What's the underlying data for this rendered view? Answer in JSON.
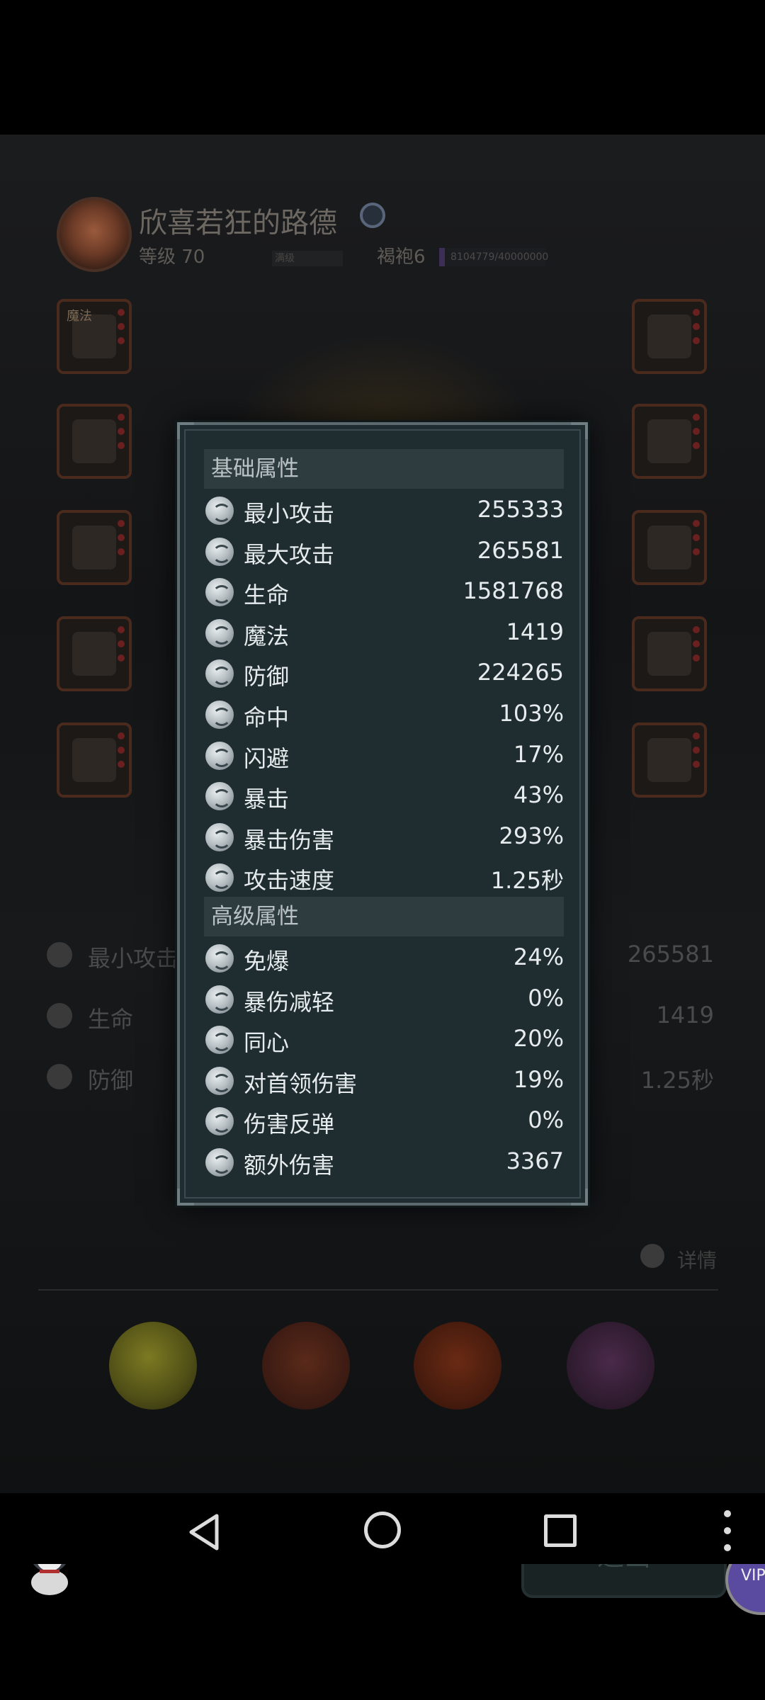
{
  "player": {
    "name": "欣喜若狂的路德",
    "level": "等级 70",
    "rank": "满级",
    "cloak": "褐袍6",
    "exp": "8104779/40000000"
  },
  "equipment": {
    "left_top_label": "魔法"
  },
  "background_stats": {
    "min_attack_label": "最小攻击",
    "life_label": "生命",
    "defense_label": "防御",
    "right_val_1": "265581",
    "right_val_2": "1419",
    "right_val_3": "1.25秒",
    "details_label": "详情"
  },
  "panel": {
    "basic_header": "基础属性",
    "basic": [
      {
        "icon": "sword-icon",
        "label": "最小攻击",
        "value": "255333"
      },
      {
        "icon": "sword-icon",
        "label": "最大攻击",
        "value": "265581"
      },
      {
        "icon": "heart-icon",
        "label": "生命",
        "value": "1581768"
      },
      {
        "icon": "magic-icon",
        "label": "魔法",
        "value": "1419"
      },
      {
        "icon": "shield-icon",
        "label": "防御",
        "value": "224265"
      },
      {
        "icon": "target-icon",
        "label": "命中",
        "value": "103%"
      },
      {
        "icon": "dodge-icon",
        "label": "闪避",
        "value": "17%"
      },
      {
        "icon": "critical-icon",
        "label": "暴击",
        "value": "43%"
      },
      {
        "icon": "critical-damage-icon",
        "label": "暴击伤害",
        "value": "293%"
      },
      {
        "icon": "attack-speed-icon",
        "label": "攻击速度",
        "value": "1.25秒"
      }
    ],
    "advanced_header": "高级属性",
    "advanced": [
      {
        "icon": "skull-icon",
        "label": "免爆",
        "value": "24%"
      },
      {
        "icon": "crit-reduction-icon",
        "label": "暴伤减轻",
        "value": "0%"
      },
      {
        "icon": "unity-icon",
        "label": "同心",
        "value": "20%"
      },
      {
        "icon": "boss-icon",
        "label": "对首领伤害",
        "value": "19%"
      },
      {
        "icon": "reflect-icon",
        "label": "伤害反弹",
        "value": "0%"
      },
      {
        "icon": "extra-damage-icon",
        "label": "额外伤害",
        "value": "3367"
      }
    ]
  },
  "exit_button": "退出",
  "side_button": "VIP"
}
